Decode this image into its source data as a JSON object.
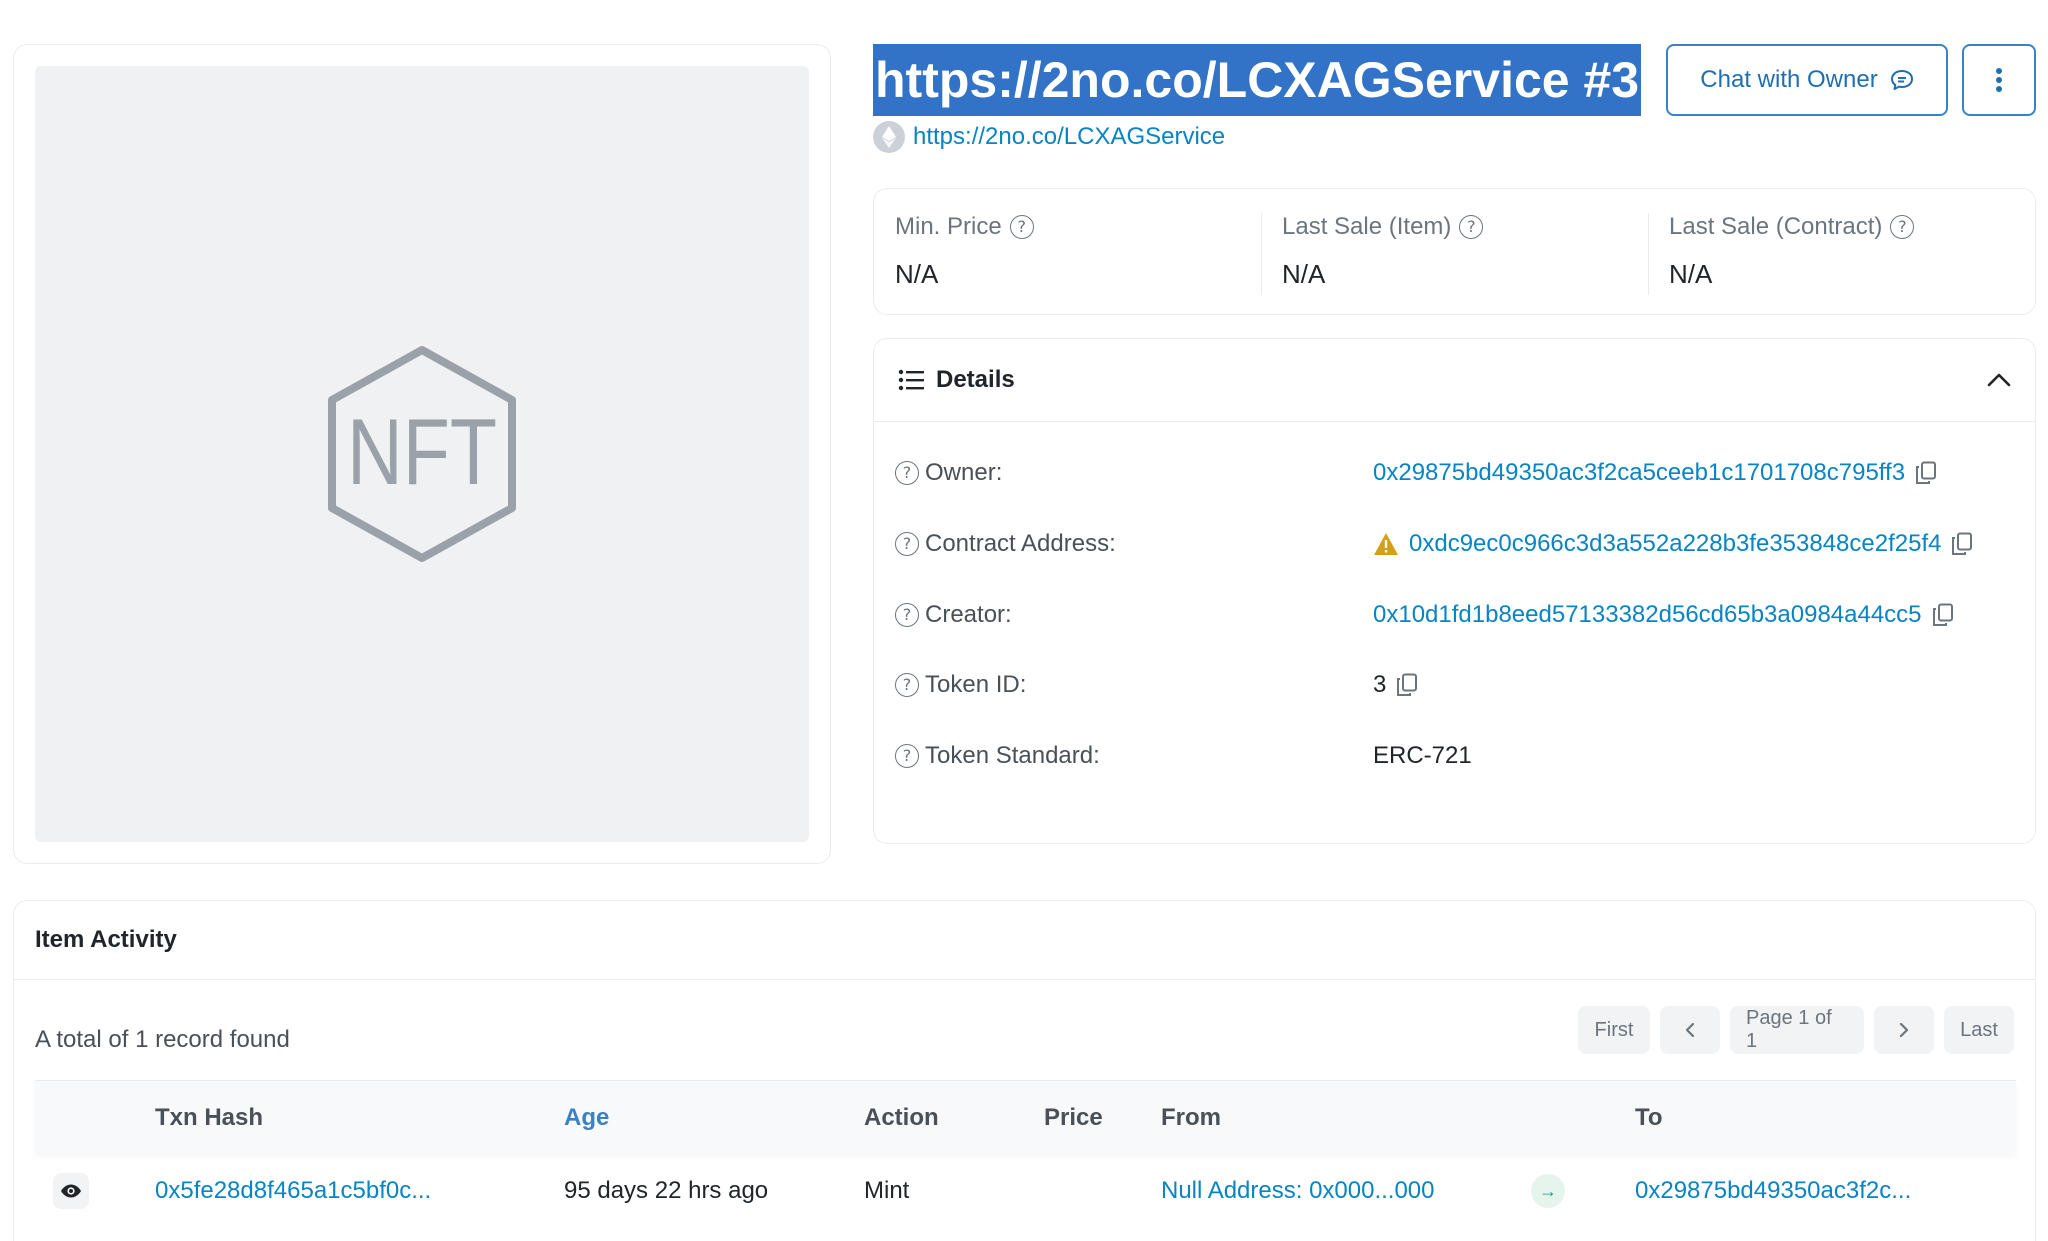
{
  "header": {
    "title": "https://2no.co/LCXAGService #3",
    "collection_link": "https://2no.co/LCXAGService",
    "chat_button": "Chat with Owner"
  },
  "nft_placeholder": {
    "text": "NFT"
  },
  "prices": [
    {
      "label": "Min. Price",
      "value": "N/A"
    },
    {
      "label": "Last Sale (Item)",
      "value": "N/A"
    },
    {
      "label": "Last Sale (Contract)",
      "value": "N/A"
    }
  ],
  "details": {
    "title": "Details",
    "owner": {
      "label": "Owner:",
      "value": "0x29875bd49350ac3f2ca5ceeb1c1701708c795ff3"
    },
    "contract": {
      "label": "Contract Address:",
      "value": "0xdc9ec0c966c3d3a552a228b3fe353848ce2f25f4"
    },
    "creator": {
      "label": "Creator:",
      "value": "0x10d1fd1b8eed57133382d56cd65b3a0984a44cc5"
    },
    "token_id": {
      "label": "Token ID:",
      "value": "3"
    },
    "token_standard": {
      "label": "Token Standard:",
      "value": "ERC-721"
    }
  },
  "activity": {
    "title": "Item Activity",
    "record_count": "A total of 1 record found",
    "pager": {
      "first": "First",
      "page": "Page 1 of 1",
      "last": "Last"
    },
    "columns": {
      "txn_hash": "Txn Hash",
      "age": "Age",
      "action": "Action",
      "price": "Price",
      "from": "From",
      "to": "To"
    },
    "rows": [
      {
        "txn_hash": "0x5fe28d8f465a1c5bf0c...",
        "age": "95 days 22 hrs ago",
        "action": "Mint",
        "price": "",
        "from": "Null Address: 0x000...000",
        "to": "0x29875bd49350ac3f2c..."
      }
    ]
  },
  "colors": {
    "link": "#0784c3",
    "title_highlight": "#3272c7",
    "warning": "#d4a017",
    "arrow_green": "#00a186"
  }
}
